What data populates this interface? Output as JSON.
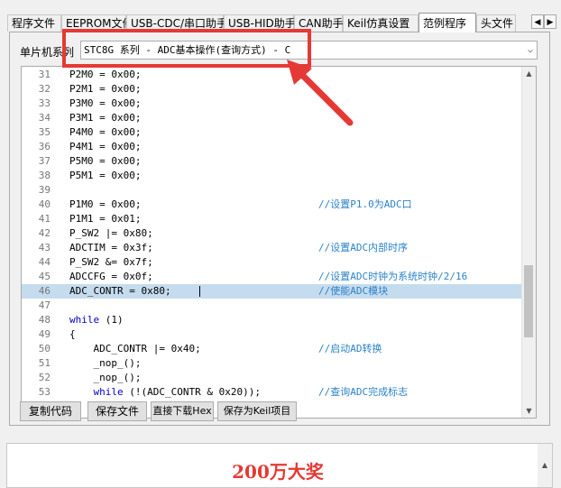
{
  "tabs": [
    {
      "label": "程序文件",
      "active": false
    },
    {
      "label": "EEPROM文件",
      "active": false
    },
    {
      "label": "USB-CDC/串口助手",
      "active": false
    },
    {
      "label": "USB-HID助手",
      "active": false
    },
    {
      "label": "CAN助手",
      "active": false
    },
    {
      "label": "Keil仿真设置",
      "active": false
    },
    {
      "label": "范例程序",
      "active": true
    },
    {
      "label": "头文件",
      "active": false
    }
  ],
  "tab_nav": {
    "prev": "◀",
    "next": "▶"
  },
  "series": {
    "label": "单片机系列",
    "selected": "STC8G 系列 - ADC基本操作(查询方式) - C",
    "arrow": "⌵"
  },
  "code_lines": [
    {
      "n": "31",
      "code": "P2M0 = 0x00;",
      "cmt": ""
    },
    {
      "n": "32",
      "code": "P2M1 = 0x00;",
      "cmt": ""
    },
    {
      "n": "33",
      "code": "P3M0 = 0x00;",
      "cmt": ""
    },
    {
      "n": "34",
      "code": "P3M1 = 0x00;",
      "cmt": ""
    },
    {
      "n": "35",
      "code": "P4M0 = 0x00;",
      "cmt": ""
    },
    {
      "n": "36",
      "code": "P4M1 = 0x00;",
      "cmt": ""
    },
    {
      "n": "37",
      "code": "P5M0 = 0x00;",
      "cmt": ""
    },
    {
      "n": "38",
      "code": "P5M1 = 0x00;",
      "cmt": ""
    },
    {
      "n": "39",
      "code": "",
      "cmt": ""
    },
    {
      "n": "40",
      "code": "P1M0 = 0x00;",
      "cmt": "//设置P1.0为ADC口"
    },
    {
      "n": "41",
      "code": "P1M1 = 0x01;",
      "cmt": ""
    },
    {
      "n": "42",
      "code": "P_SW2 |= 0x80;",
      "cmt": ""
    },
    {
      "n": "43",
      "code": "ADCTIM = 0x3f;",
      "cmt": "//设置ADC内部时序"
    },
    {
      "n": "44",
      "code": "P_SW2 &= 0x7f;",
      "cmt": ""
    },
    {
      "n": "45",
      "code": "ADCCFG = 0x0f;",
      "cmt": "//设置ADC时钟为系统时钟/2/16"
    },
    {
      "n": "46",
      "code": "ADC_CONTR = 0x80;",
      "cmt": "//使能ADC模块",
      "highlight": true
    },
    {
      "n": "47",
      "code": "",
      "cmt": ""
    },
    {
      "n": "48",
      "code": "while (1)",
      "cmt": "",
      "kw": "while"
    },
    {
      "n": "49",
      "code": "{",
      "cmt": ""
    },
    {
      "n": "50",
      "code": "    ADC_CONTR |= 0x40;",
      "cmt": "//启动AD转换"
    },
    {
      "n": "51",
      "code": "    _nop_();",
      "cmt": ""
    },
    {
      "n": "52",
      "code": "    _nop_();",
      "cmt": ""
    },
    {
      "n": "53",
      "code": "    while (!(ADC_CONTR & 0x20));",
      "cmt": "//查询ADC完成标志",
      "kw": "while"
    }
  ],
  "buttons": {
    "copy": "复制代码",
    "save": "保存文件",
    "download": "直接下载Hex",
    "save_keil": "保存为Keil项目"
  },
  "scroll": {
    "up": "▲",
    "down": "▼"
  },
  "banner": {
    "text": "200万大奖"
  },
  "colors": {
    "annotation": "#e53935",
    "highlight": "#c5dcee",
    "comment": "#2b82c8",
    "keyword": "#0000c8"
  }
}
